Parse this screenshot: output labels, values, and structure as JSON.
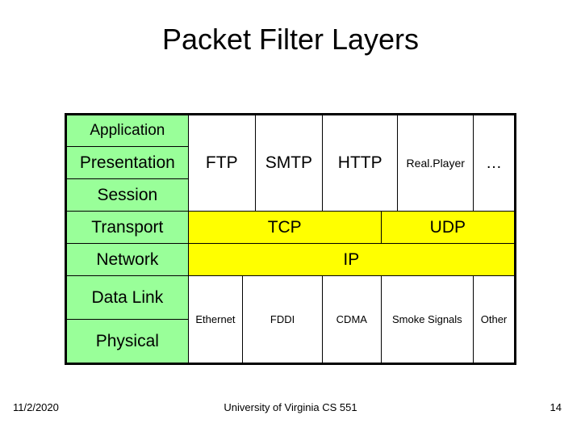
{
  "title": "Packet Filter Layers",
  "osi": {
    "application": "Application",
    "presentation": "Presentation",
    "session": "Session",
    "transport": "Transport",
    "network": "Network",
    "datalink": "Data Link",
    "physical": "Physical"
  },
  "apps": {
    "ftp": "FTP",
    "smtp": "SMTP",
    "http": "HTTP",
    "realplayer": "Real.Player",
    "more": "…"
  },
  "transport": {
    "tcp": "TCP",
    "udp": "UDP"
  },
  "network": {
    "ip": "IP"
  },
  "link": {
    "ethernet": "Ethernet",
    "fddi": "FDDI",
    "cdma": "CDMA",
    "smoke": "Smoke Signals",
    "other": "Other"
  },
  "footer": {
    "date": "11/2/2020",
    "center": "University of Virginia CS 551",
    "page": "14"
  }
}
